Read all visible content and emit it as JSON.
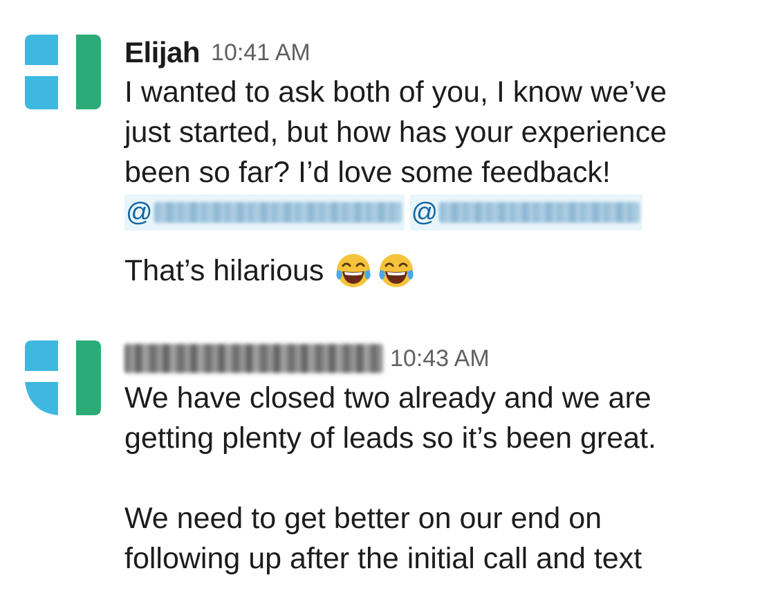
{
  "messages": [
    {
      "author": "Elijah",
      "timestamp": "10:41 AM",
      "lines": [
        "I wanted to ask both of you, I know we’ve",
        "just started, but how has your experience",
        "been so far? I’d love some feedback!"
      ],
      "mention_prefix": "@",
      "follow_up": "That’s hilarious",
      "emojis": [
        "face-with-tears-of-joy",
        "face-with-tears-of-joy"
      ]
    },
    {
      "author": "",
      "timestamp": "10:43 AM",
      "paragraph_1": [
        "We have closed two already and we are",
        "getting plenty of leads so it’s been great."
      ],
      "paragraph_2": [
        "We need to get better on our end on",
        "following up after the initial call and text"
      ]
    }
  ],
  "colors": {
    "avatar_blue": "#3fb8e0",
    "avatar_green": "#2bac76",
    "mention_bg": "#e8f5fa",
    "mention_text": "#1264a3",
    "timestamp": "#616061"
  }
}
